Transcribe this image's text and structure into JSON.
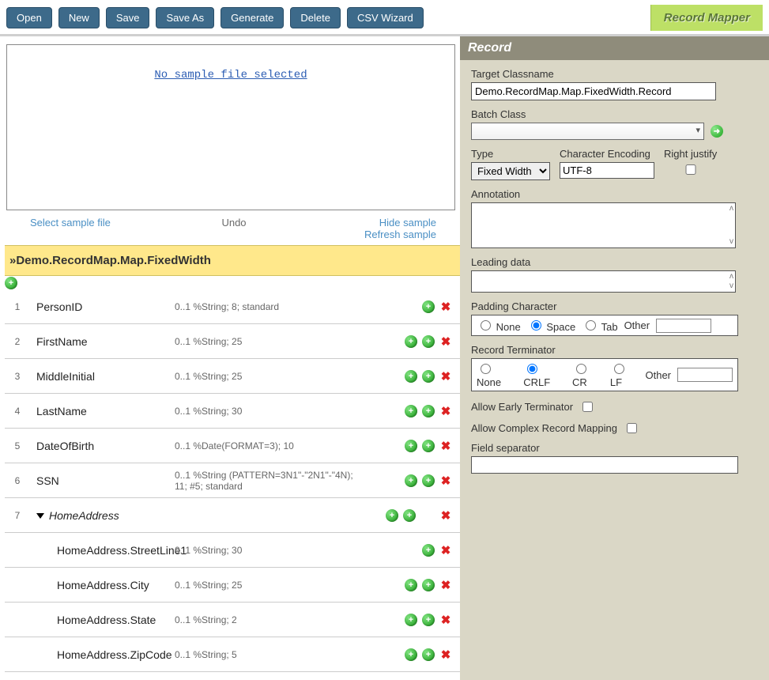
{
  "toolbar": {
    "open": "Open",
    "new": "New",
    "save": "Save",
    "save_as": "Save As",
    "generate": "Generate",
    "delete": "Delete",
    "csv_wizard": "CSV Wizard",
    "title_badge": "Record Mapper"
  },
  "sample": {
    "no_sample": "No sample file selected",
    "select_file": "Select sample file",
    "undo": "Undo",
    "hide_sample": "Hide sample",
    "refresh_sample": "Refresh sample"
  },
  "group": {
    "header_prefix": "» ",
    "name": "Demo.RecordMap.Map.FixedWidth"
  },
  "fields": [
    {
      "num": "1",
      "name": "PersonID",
      "info": "0..1 %String; 8; standard",
      "icons": [
        "add",
        "del"
      ],
      "nested": false
    },
    {
      "num": "2",
      "name": "FirstName",
      "info": "0..1 %String; 25",
      "icons": [
        "add",
        "add",
        "del"
      ],
      "nested": false
    },
    {
      "num": "3",
      "name": "MiddleInitial",
      "info": "0..1 %String; 25",
      "icons": [
        "add",
        "add",
        "del"
      ],
      "nested": false
    },
    {
      "num": "4",
      "name": "LastName",
      "info": "0..1 %String; 30",
      "icons": [
        "add",
        "add",
        "del"
      ],
      "nested": false
    },
    {
      "num": "5",
      "name": "DateOfBirth",
      "info": "0..1 %Date(FORMAT=3); 10",
      "icons": [
        "add",
        "add",
        "del"
      ],
      "nested": false
    },
    {
      "num": "6",
      "name": "SSN",
      "info": "0..1 %String (PATTERN=3N1\"-\"2N1\"-\"4N); 11; #5; standard",
      "icons": [
        "add",
        "add",
        "del"
      ],
      "nested": false
    },
    {
      "num": "7",
      "name": "HomeAddress",
      "info": "",
      "icons": [
        "add",
        "add",
        "gap",
        "del"
      ],
      "nested": false,
      "composite": true
    },
    {
      "num": "",
      "name": "HomeAddress.StreetLine1",
      "info": "0..1 %String; 30",
      "icons": [
        "add",
        "del"
      ],
      "nested": true
    },
    {
      "num": "",
      "name": "HomeAddress.City",
      "info": "0..1 %String; 25",
      "icons": [
        "add",
        "add",
        "del"
      ],
      "nested": true
    },
    {
      "num": "",
      "name": "HomeAddress.State",
      "info": "0..1 %String; 2",
      "icons": [
        "add",
        "add",
        "del"
      ],
      "nested": true
    },
    {
      "num": "",
      "name": "HomeAddress.ZipCode",
      "info": "0..1 %String; 5",
      "icons": [
        "add",
        "add",
        "del"
      ],
      "nested": true
    }
  ],
  "right": {
    "panel_title": "Record",
    "target_classname_label": "Target Classname",
    "target_classname_value": "Demo.RecordMap.Map.FixedWidth.Record",
    "batch_class_label": "Batch Class",
    "batch_class_value": "",
    "type_label": "Type",
    "type_value": "Fixed Width",
    "encoding_label": "Character Encoding",
    "encoding_value": "UTF-8",
    "right_justify_label": "Right justify",
    "annotation_label": "Annotation",
    "leading_label": "Leading data",
    "padding_label": "Padding Character",
    "padding_options": {
      "none": "None",
      "space": "Space",
      "tab": "Tab",
      "other": "Other"
    },
    "padding_selected": "space",
    "terminator_label": "Record Terminator",
    "terminator_options": {
      "none": "None",
      "crlf": "CRLF",
      "cr": "CR",
      "lf": "LF",
      "other": "Other"
    },
    "terminator_selected": "crlf",
    "allow_early_label": "Allow Early Terminator",
    "allow_complex_label": "Allow Complex Record Mapping",
    "field_sep_label": "Field separator"
  }
}
